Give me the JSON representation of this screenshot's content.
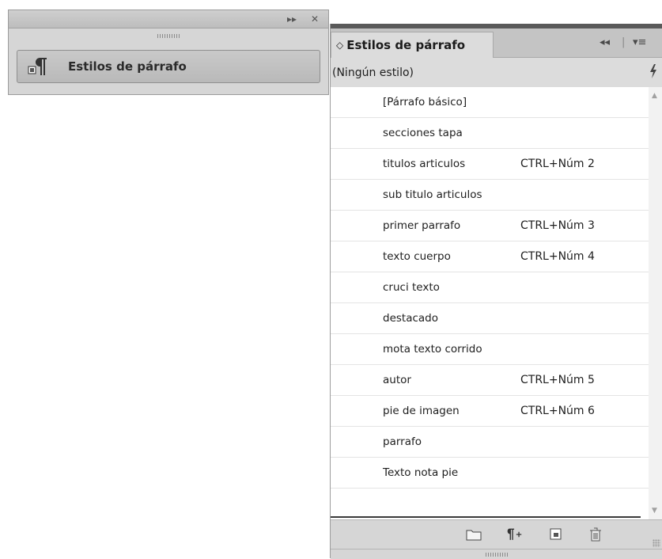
{
  "mini_panel": {
    "label": "Estilos de párrafo",
    "controls": {
      "collapse": "▸▸",
      "close": "✕"
    }
  },
  "panel": {
    "tab": {
      "updown": "◇",
      "label": "Estilos de párrafo"
    },
    "controls": {
      "expand": "◂◂",
      "menu": "▾≡"
    },
    "current_style": "(Ningún estilo)",
    "styles": [
      {
        "name": "[Párrafo básico]",
        "shortcut": ""
      },
      {
        "name": "secciones tapa",
        "shortcut": ""
      },
      {
        "name": "titulos articulos",
        "shortcut": "CTRL+Núm 2"
      },
      {
        "name": "sub titulo articulos",
        "shortcut": ""
      },
      {
        "name": "primer parrafo",
        "shortcut": "CTRL+Núm 3"
      },
      {
        "name": "texto cuerpo",
        "shortcut": "CTRL+Núm 4"
      },
      {
        "name": "cruci texto",
        "shortcut": ""
      },
      {
        "name": "destacado",
        "shortcut": ""
      },
      {
        "name": "mota texto corrido",
        "shortcut": ""
      },
      {
        "name": "autor",
        "shortcut": "CTRL+Núm 5"
      },
      {
        "name": "pie de imagen",
        "shortcut": "CTRL+Núm 6"
      },
      {
        "name": "parrafo",
        "shortcut": ""
      },
      {
        "name": "Texto nota pie",
        "shortcut": ""
      }
    ],
    "footer_icons": [
      "folder-icon",
      "new-style-override-icon",
      "new-style-icon",
      "trash-icon"
    ]
  }
}
